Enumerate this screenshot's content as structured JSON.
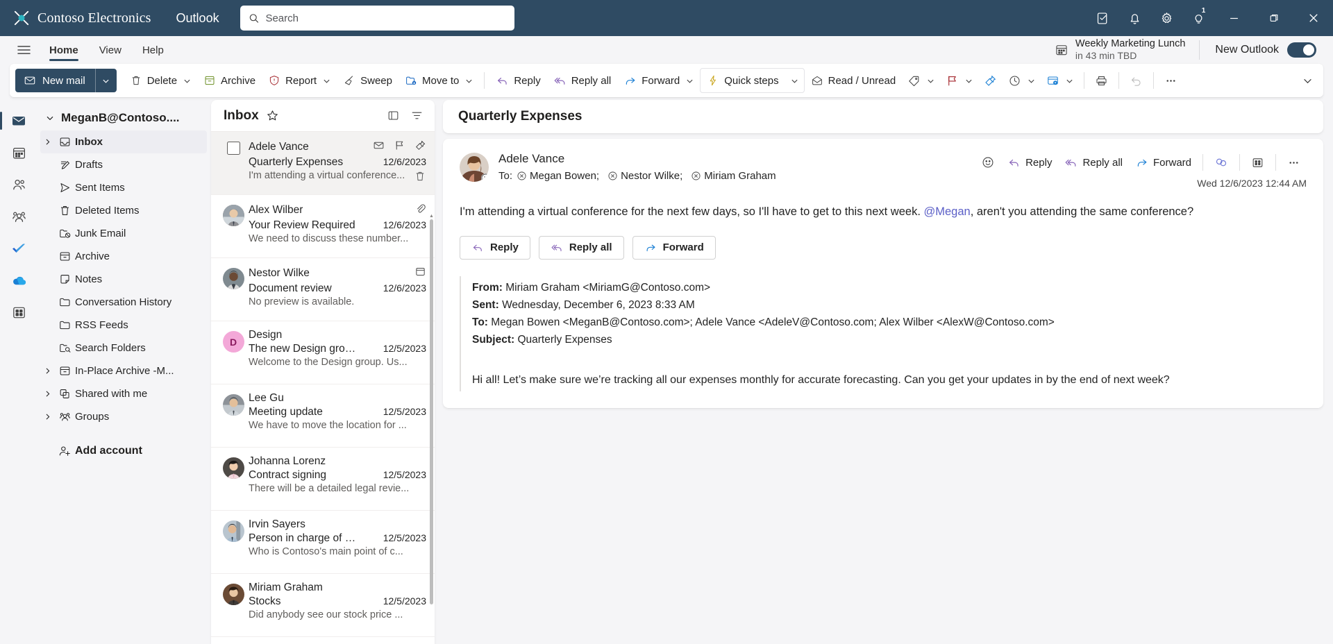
{
  "titlebar": {
    "brand": "Contoso Electronics",
    "app_name": "Outlook",
    "search_placeholder": "Search",
    "icons": [
      {
        "name": "tasks-icon",
        "label": "Tasks"
      },
      {
        "name": "notifications-bell-icon",
        "label": "Notifications"
      },
      {
        "name": "settings-gear-icon",
        "label": "Settings"
      },
      {
        "name": "help-lightbulb-icon",
        "label": "Help",
        "badge": "1"
      }
    ],
    "window_controls": [
      {
        "name": "minimize-button",
        "glyph": "─"
      },
      {
        "name": "restore-button",
        "glyph": "❐"
      },
      {
        "name": "close-button",
        "glyph": "✕"
      }
    ]
  },
  "ribbon": {
    "tabs": [
      {
        "label": "Home",
        "active": true
      },
      {
        "label": "View",
        "active": false
      },
      {
        "label": "Help",
        "active": false
      }
    ],
    "meeting": {
      "title": "Weekly Marketing Lunch",
      "subtitle": "in 43 min TBD"
    },
    "new_outlook_label": "New Outlook",
    "new_outlook_on": true
  },
  "commandbar": {
    "new_mail": "New mail",
    "commands": [
      {
        "label": "Delete",
        "icon": "trash-icon",
        "caret": true
      },
      {
        "label": "Archive",
        "icon": "archive-box-icon",
        "caret": false
      },
      {
        "label": "Report",
        "icon": "report-shield-icon",
        "caret": true
      },
      {
        "label": "Sweep",
        "icon": "sweep-broom-icon",
        "caret": false
      },
      {
        "label": "Move to",
        "icon": "move-folder-icon",
        "caret": true
      },
      {
        "label": "Reply",
        "icon": "reply-arrow-icon",
        "caret": false
      },
      {
        "label": "Reply all",
        "icon": "reply-all-arrow-icon",
        "caret": false
      },
      {
        "label": "Forward",
        "icon": "forward-arrow-icon",
        "caret": true
      },
      {
        "label": "Quick steps",
        "icon": "quick-steps-lightning-icon",
        "caret": true
      },
      {
        "label": "Read / Unread",
        "icon": "envelope-open-icon",
        "caret": false
      }
    ],
    "icon_commands": [
      {
        "name": "categorize-tag-icon",
        "caret": true
      },
      {
        "name": "flag-icon",
        "caret": true
      },
      {
        "name": "pin-icon",
        "caret": false
      },
      {
        "name": "snooze-clock-icon",
        "caret": true
      },
      {
        "name": "rules-icon",
        "caret": true
      },
      {
        "name": "print-icon",
        "caret": false
      },
      {
        "name": "undo-icon",
        "caret": false
      },
      {
        "name": "more-options-icon",
        "caret": false
      }
    ]
  },
  "rail": [
    {
      "name": "mail-icon",
      "label": "Mail",
      "active": true
    },
    {
      "name": "calendar-icon",
      "label": "Calendar",
      "active": false
    },
    {
      "name": "people-icon",
      "label": "People",
      "active": false
    },
    {
      "name": "groups-icon",
      "label": "Groups",
      "active": false
    },
    {
      "name": "todo-check-icon",
      "label": "To Do",
      "active": false
    },
    {
      "name": "onedrive-cloud-icon",
      "label": "OneDrive",
      "active": false
    },
    {
      "name": "apps-grid-icon",
      "label": "More apps",
      "active": false
    }
  ],
  "folderpane": {
    "account": "MeganB@Contoso....",
    "folders": [
      {
        "label": "Inbox",
        "icon": "inbox-icon",
        "expandable": true,
        "selected": true
      },
      {
        "label": "Drafts",
        "icon": "drafts-pencil-icon",
        "expandable": false,
        "selected": false
      },
      {
        "label": "Sent Items",
        "icon": "sent-paperplane-icon",
        "expandable": false,
        "selected": false
      },
      {
        "label": "Deleted Items",
        "icon": "trash-icon",
        "expandable": false,
        "selected": false
      },
      {
        "label": "Junk Email",
        "icon": "junk-folder-icon",
        "expandable": false,
        "selected": false
      },
      {
        "label": "Archive",
        "icon": "archive-box-icon",
        "expandable": false,
        "selected": false
      },
      {
        "label": "Notes",
        "icon": "note-icon",
        "expandable": false,
        "selected": false
      },
      {
        "label": "Conversation History",
        "icon": "folder-icon",
        "expandable": false,
        "selected": false
      },
      {
        "label": "RSS Feeds",
        "icon": "folder-icon",
        "expandable": false,
        "selected": false
      },
      {
        "label": "Search Folders",
        "icon": "search-folder-icon",
        "expandable": false,
        "selected": false
      },
      {
        "label": "In-Place Archive -M...",
        "icon": "archive-box-icon",
        "expandable": true,
        "selected": false
      },
      {
        "label": "Shared with me",
        "icon": "shared-icon",
        "expandable": true,
        "selected": false
      },
      {
        "label": "Groups",
        "icon": "groups-icon",
        "expandable": true,
        "selected": false
      }
    ],
    "add_account": "Add account"
  },
  "messagelist": {
    "title": "Inbox",
    "header_icons": [
      {
        "name": "focused-other-toggle-icon"
      },
      {
        "name": "filter-icon"
      }
    ],
    "messages": [
      {
        "sender": "Adele Vance",
        "subject": "Quarterly Expenses",
        "date": "12/6/2023",
        "preview": "I'm attending a virtual conference...",
        "selected": true,
        "avatar_type": "checkbox",
        "avatar_color": "#c19a86",
        "initial": "A",
        "icons": [
          "envelope-icon",
          "flag-icon",
          "pin-icon"
        ],
        "trash": true
      },
      {
        "sender": "Alex Wilber",
        "subject": "Your Review Required",
        "date": "12/6/2023",
        "preview": "We need to discuss these number...",
        "selected": false,
        "avatar_type": "photo",
        "avatar_color": "#7d6b5d",
        "initial": "A",
        "icons": [
          "attachment-icon"
        ],
        "trash": false
      },
      {
        "sender": "Nestor Wilke",
        "subject": "Document review",
        "date": "12/6/2023",
        "preview": "No preview is available.",
        "selected": false,
        "avatar_type": "photo",
        "avatar_color": "#6b5b4b",
        "initial": "N",
        "icons": [
          "calendar-event-icon"
        ],
        "trash": false
      },
      {
        "sender": "Design",
        "subject": "The new Design grou...",
        "date": "12/5/2023",
        "preview": "Welcome to the Design group. Us...",
        "selected": false,
        "avatar_type": "initial",
        "avatar_color": "#f3a8d8",
        "initial": "D",
        "icons": [],
        "trash": false
      },
      {
        "sender": "Lee Gu",
        "subject": "Meeting update",
        "date": "12/5/2023",
        "preview": "We have to move the location for ...",
        "selected": false,
        "avatar_type": "photo",
        "avatar_color": "#8a7a68",
        "initial": "L",
        "icons": [],
        "trash": false
      },
      {
        "sender": "Johanna Lorenz",
        "subject": "Contract signing",
        "date": "12/5/2023",
        "preview": "There will be a detailed legal revie...",
        "selected": false,
        "avatar_type": "photo",
        "avatar_color": "#5c4a3f",
        "initial": "J",
        "icons": [],
        "trash": false
      },
      {
        "sender": "Irvin Sayers",
        "subject": "Person in charge of Pr...",
        "date": "12/5/2023",
        "preview": "Who is Contoso's main point of c...",
        "selected": false,
        "avatar_type": "photo",
        "avatar_color": "#7e8ca0",
        "initial": "I",
        "icons": [],
        "trash": false
      },
      {
        "sender": "Miriam Graham",
        "subject": "Stocks",
        "date": "12/5/2023",
        "preview": "Did anybody see our stock price ...",
        "selected": false,
        "avatar_type": "photo",
        "avatar_color": "#6e5646",
        "initial": "M",
        "icons": [],
        "trash": false
      }
    ]
  },
  "reading": {
    "subject": "Quarterly Expenses",
    "from": "Adele Vance",
    "to_label": "To:",
    "recipients": [
      "Megan Bowen;",
      "Nestor Wilke;",
      "Miriam Graham"
    ],
    "timestamp": "Wed 12/6/2023 12:44 AM",
    "head_actions": [
      {
        "label": "",
        "icon": "reaction-smiley-icon"
      },
      {
        "label": "Reply",
        "icon": "reply-arrow-icon"
      },
      {
        "label": "Reply all",
        "icon": "reply-all-arrow-icon"
      },
      {
        "label": "Forward",
        "icon": "forward-arrow-icon"
      },
      {
        "label": "",
        "icon": "loop-icon"
      },
      {
        "label": "",
        "icon": "apps-grid-icon"
      },
      {
        "label": "",
        "icon": "more-options-icon"
      }
    ],
    "body_before_mention": "I'm attending a virtual conference for the next few days, so I'll have to get to this next week.  ",
    "mention": "@Megan",
    "body_after_mention": ", aren't you attending the same conference?",
    "buttons": [
      {
        "label": "Reply",
        "icon": "reply-arrow-icon"
      },
      {
        "label": "Reply all",
        "icon": "reply-all-arrow-icon"
      },
      {
        "label": "Forward",
        "icon": "forward-arrow-icon"
      }
    ],
    "quoted": {
      "from_label": "From:",
      "from_value": "Miriam Graham <MiriamG@Contoso.com>",
      "sent_label": "Sent:",
      "sent_value": "Wednesday, December 6, 2023 8:33 AM",
      "to_label": "To:",
      "to_value": "Megan Bowen <MeganB@Contoso.com>; Adele Vance <AdeleV@Contoso.com; Alex Wilber <AlexW@Contoso.com>",
      "subject_label": "Subject:",
      "subject_value": "Quarterly Expenses",
      "body": "Hi all! Let’s make sure we’re tracking all our expenses monthly for accurate forecasting. Can you get your updates in by the end of next week?"
    }
  },
  "colors": {
    "brand_navy": "#2f4b63",
    "accent_purple": "#8764b8",
    "mention_blue": "#5b5fc7",
    "report_red": "#a4262c",
    "archive_green": "#498205"
  }
}
